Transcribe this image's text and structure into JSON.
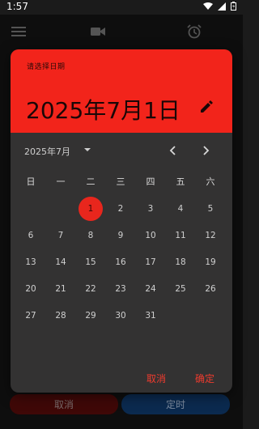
{
  "status_bar": {
    "time": "1:57"
  },
  "dialog": {
    "hint": "请选择日期",
    "selected_date": "2025年7月1日",
    "month_label": "2025年7月",
    "weekdays": [
      "日",
      "一",
      "二",
      "三",
      "四",
      "五",
      "六"
    ],
    "weeks": [
      [
        "",
        "",
        "1",
        "2",
        "3",
        "4",
        "5"
      ],
      [
        "6",
        "7",
        "8",
        "9",
        "10",
        "11",
        "12"
      ],
      [
        "13",
        "14",
        "15",
        "16",
        "17",
        "18",
        "19"
      ],
      [
        "20",
        "21",
        "22",
        "23",
        "24",
        "25",
        "26"
      ],
      [
        "27",
        "28",
        "29",
        "30",
        "31",
        "",
        ""
      ]
    ],
    "selected_day": "1",
    "cancel_label": "取消",
    "ok_label": "确定"
  },
  "background_buttons": {
    "cancel_label": "取消",
    "ok_label": "定时"
  },
  "colors": {
    "accent": "#f2241b",
    "dialog_bg": "#333232",
    "primary_button": "#0b2a4f"
  },
  "icons": [
    "wifi-icon",
    "signal-icon",
    "battery-icon",
    "menu-icon",
    "video-camera-icon",
    "alarm-icon",
    "edit-pencil-icon",
    "dropdown-arrow-icon",
    "chevron-left-icon",
    "chevron-right-icon"
  ]
}
